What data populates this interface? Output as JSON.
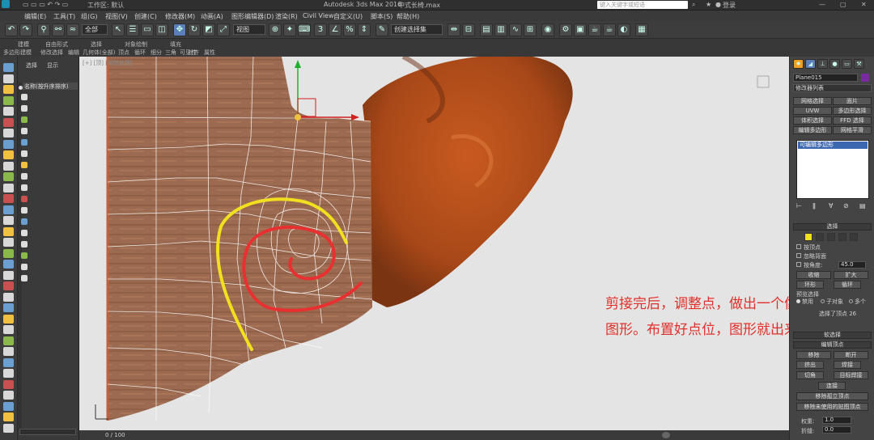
{
  "titlebar": {
    "workspace": "工作区: 默认",
    "app_title": "Autodesk 3ds Max 2016",
    "file_name": "中式长椅.max",
    "search_placeholder": "键入关键字或短语",
    "user": "登录"
  },
  "menu": [
    "编辑(E)",
    "工具(T)",
    "组(G)",
    "视图(V)",
    "创建(C)",
    "修改器(M)",
    "动画(A)",
    "图形编辑器(D)",
    "渲染(R)",
    "Civil View",
    "自定义(U)",
    "脚本(S)",
    "帮助(H)"
  ],
  "toolbar": {
    "filter_select": "全部",
    "coord_select": "视图",
    "named_selection": "创建选择集"
  },
  "ribbon": {
    "tabs": [
      "建模",
      "自由形式",
      "选择",
      "对象绘制",
      "填充"
    ],
    "sub": [
      "多边形建模",
      "修改选择",
      "编辑",
      "几何体(全部)",
      "顶点",
      "循环",
      "细分",
      "三角",
      "可见性",
      "对齐",
      "属性"
    ]
  },
  "scene_panel": {
    "tabs": [
      "选择",
      "显示"
    ],
    "column_header": "名称(按升序排序)"
  },
  "viewport": {
    "label": "[+] [顶] [明暗处理]"
  },
  "annotation": {
    "line1": "剪接完后，调整点，做出一个像蜗牛壳的",
    "line2": "图形。布置好点位，图形就出来了"
  },
  "status": {
    "frame_counter": "0 / 100"
  },
  "cmd_panel": {
    "object_name": "Plane015",
    "modifier_list": "修改器列表",
    "buttons": [
      "网格选择",
      "面片",
      "UVW",
      "多边形选择",
      "体积选择",
      "FFD 选择",
      "编辑多边形",
      "网格平滑"
    ],
    "stack_item": "可编辑多边形",
    "selection_header": "选择",
    "by_vertex": "按顶点",
    "ignore_backface": "忽略背面",
    "by_angle": "按角度:",
    "angle_value": "45.0",
    "shrink": "收缩",
    "grow": "扩大",
    "ring": "环形",
    "loop": "循环",
    "preview_header": "预览选择",
    "preview_off": "禁用",
    "preview_sub": "子对象",
    "preview_multi": "多个",
    "selected_info": "选择了顶点 26",
    "soft_selection": "软选择",
    "edit_vertices": "编辑顶点",
    "remove": "移除",
    "break": "断开",
    "extrude": "挤出",
    "weld": "焊接",
    "chamfer": "切角",
    "target_weld": "目标焊接",
    "connect": "连接",
    "remove_isolated": "移除孤立顶点",
    "remove_unused": "移除未使用的贴图顶点",
    "weight_label": "权重:",
    "weight_value": "1.0",
    "crease_label": "折缝:",
    "crease_value": "0.0"
  },
  "colors": {
    "wood": "#a06848",
    "annotation_red": "#e0302a",
    "spiral_yellow": "#f0e020",
    "spiral_red": "#e83030",
    "wire": "#ffffff",
    "viewport_bg": "#e4e4e4"
  }
}
